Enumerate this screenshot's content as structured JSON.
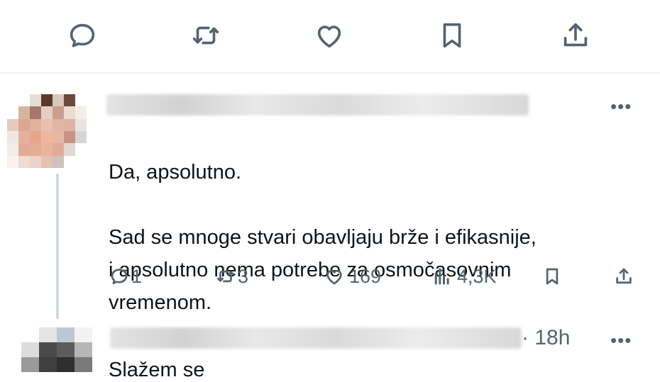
{
  "actions_bar": {
    "items": [
      {
        "name": "reply-icon"
      },
      {
        "name": "retweet-icon"
      },
      {
        "name": "like-icon"
      },
      {
        "name": "bookmark-icon"
      },
      {
        "name": "share-icon"
      }
    ]
  },
  "reply1": {
    "text_line1": "Da, apsolutno.",
    "text_body": "Sad se mnoge stvari obavljaju brže i efikasnije,\ni apsolutno nema potrebe za osmočasovnim\nvremenom.",
    "more_label": "•••",
    "stats": {
      "replies": "1",
      "reposts": "3",
      "likes": "169",
      "views": "4,3K"
    }
  },
  "reply2": {
    "time": "· 18h",
    "more_label": "•••",
    "text": "Slažem se"
  },
  "colors": {
    "icon": "#536471",
    "text": "#0f1419",
    "divider": "#eff3f4",
    "thread": "#cfd9de"
  }
}
